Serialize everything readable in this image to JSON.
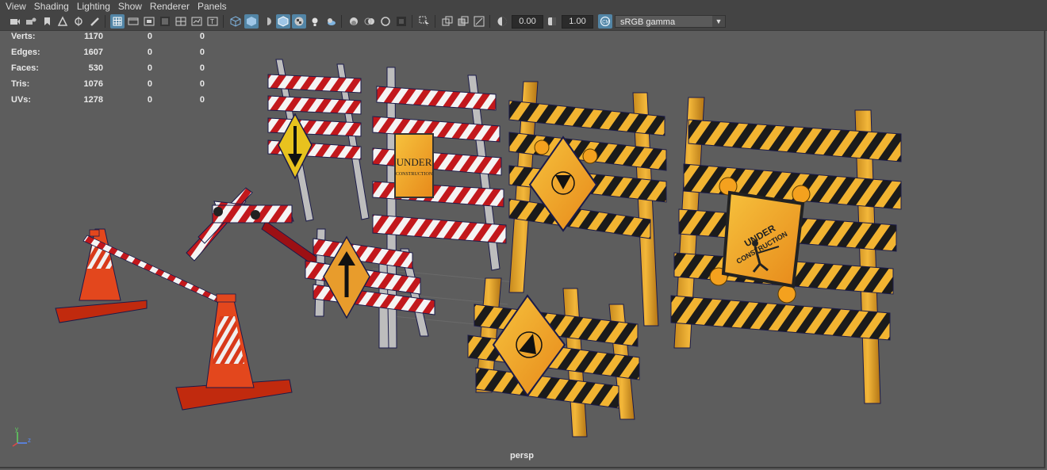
{
  "menu": [
    "View",
    "Shading",
    "Lighting",
    "Show",
    "Renderer",
    "Panels"
  ],
  "toolbar": {
    "exposure_value": "0.00",
    "gamma_value": "1.00",
    "colorspace": "sRGB gamma"
  },
  "hud": [
    {
      "label": "Verts:",
      "v1": "1170",
      "v2": "0",
      "v3": "0"
    },
    {
      "label": "Edges:",
      "v1": "1607",
      "v2": "0",
      "v3": "0"
    },
    {
      "label": "Faces:",
      "v1": "530",
      "v2": "0",
      "v3": "0"
    },
    {
      "label": "Tris:",
      "v1": "1076",
      "v2": "0",
      "v3": "0"
    },
    {
      "label": "UVs:",
      "v1": "1278",
      "v2": "0",
      "v3": "0"
    }
  ],
  "camera": "persp",
  "axis": {
    "y": "y",
    "z": "z"
  },
  "signs": {
    "under": "UNDER",
    "construction": "CONSTRUCTION"
  },
  "colors": {
    "viewport_bg": "#5d5d5d",
    "ui_bg": "#444444",
    "accent": "#5285a6"
  }
}
